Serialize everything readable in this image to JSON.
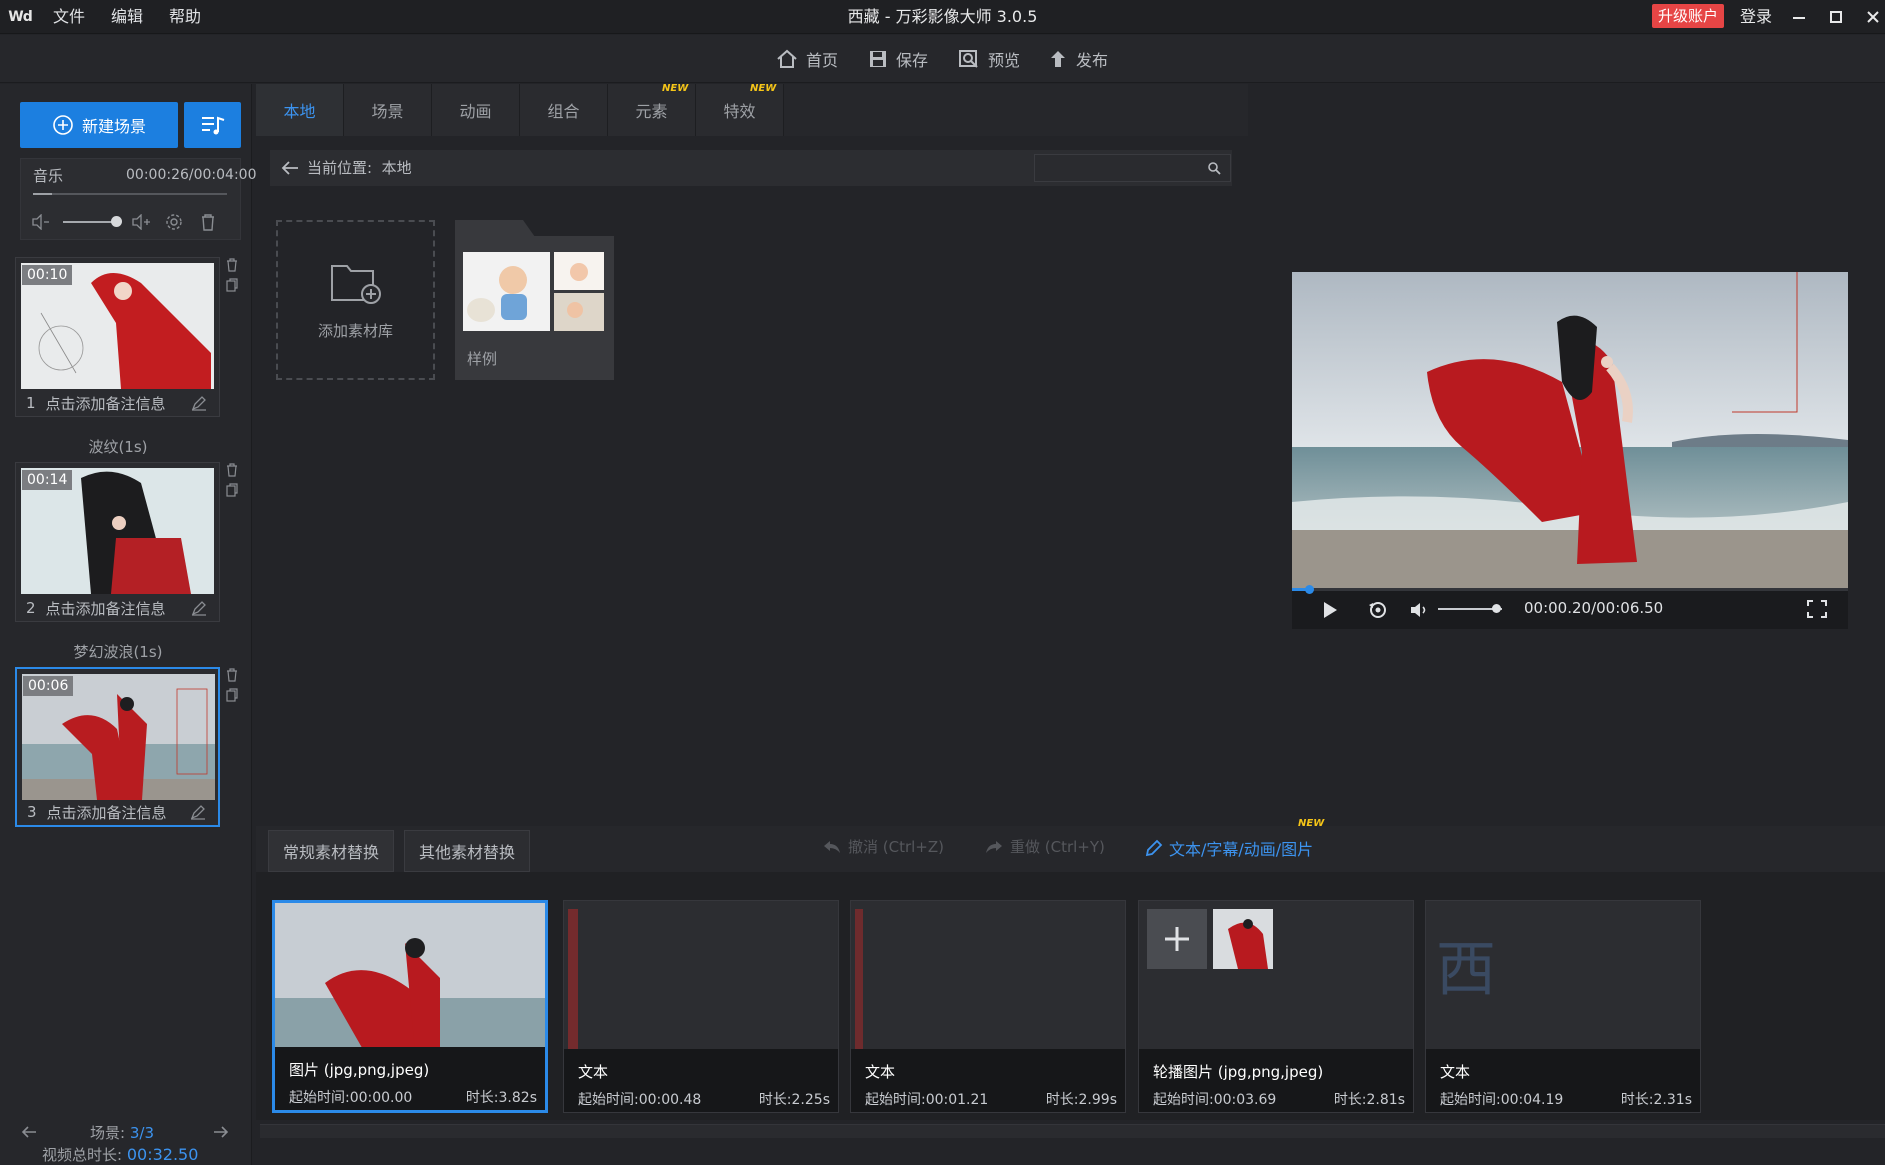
{
  "app": {
    "logo_text": "Wd",
    "window_title": "西藏 - 万彩影像大师 3.0.5",
    "upgrade_label": "升级账户",
    "login_label": "登录"
  },
  "menu": [
    "文件",
    "编辑",
    "帮助"
  ],
  "toolbar": {
    "home": "首页",
    "save": "保存",
    "preview": "预览",
    "publish": "发布"
  },
  "left": {
    "new_scene": "新建场景",
    "music_label": "音乐",
    "music_time": "00:00:26/00:04:00",
    "music_progress": 0.1,
    "scenes": [
      {
        "duration": "00:10",
        "index": "1",
        "note": "点击添加备注信息"
      },
      {
        "duration": "00:14",
        "index": "2",
        "note": "点击添加备注信息"
      },
      {
        "duration": "00:06",
        "index": "3",
        "note": "点击添加备注信息"
      }
    ],
    "transitions": [
      "波纹(1s)",
      "梦幻波浪(1s)"
    ],
    "scene_counter_label": "场景:",
    "scene_counter_value": "3/3",
    "total_label": "视频总时长:",
    "total_value": "00:32.50"
  },
  "tabs": [
    "本地",
    "场景",
    "动画",
    "组合",
    "元素",
    "特效"
  ],
  "new_badge": "NEW",
  "path": {
    "label": "当前位置:",
    "value": "本地"
  },
  "library": {
    "add_label": "添加素材库",
    "sample_label": "样例"
  },
  "player": {
    "time": "00:00.20/00:06.50",
    "progress": 0.03,
    "volume": 0.9
  },
  "bottom": {
    "tab_regular": "常规素材替换",
    "tab_other": "其他素材替换",
    "undo": "撤消 (Ctrl+Z)",
    "redo": "重做 (Ctrl+Y)",
    "text_edit": "文本/字幕/动画/图片",
    "clips": [
      {
        "name": "图片 (jpg,png,jpeg)",
        "start": "起始时间:00:00.00",
        "duration": "时长:3.82s"
      },
      {
        "name": "文本",
        "start": "起始时间:00:00.48",
        "duration": "时长:2.25s"
      },
      {
        "name": "文本",
        "start": "起始时间:00:01.21",
        "duration": "时长:2.99s"
      },
      {
        "name": "轮播图片 (jpg,png,jpeg)",
        "start": "起始时间:00:03.69",
        "duration": "时长:2.81s"
      },
      {
        "name": "文本",
        "start": "起始时间:00:04.19",
        "duration": "时长:2.31s"
      }
    ],
    "text_preview": "西"
  },
  "colors": {
    "accent": "#1c7fe0",
    "active_blue": "#2b8ae8",
    "upgrade_red": "#e64545",
    "badge_yellow": "#f5c518"
  }
}
